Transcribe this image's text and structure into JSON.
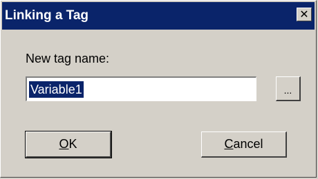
{
  "window": {
    "title": "Linking a Tag",
    "close_glyph": "✕"
  },
  "form": {
    "label": "New tag name:",
    "value": "Variable1",
    "browse_label": "..."
  },
  "buttons": {
    "ok_mnemonic": "O",
    "ok_rest": "K",
    "cancel_mnemonic": "C",
    "cancel_rest": "ancel"
  },
  "colors": {
    "titlebar": "#0a246a",
    "face": "#d4d0c8",
    "selection": "#0a246a"
  }
}
